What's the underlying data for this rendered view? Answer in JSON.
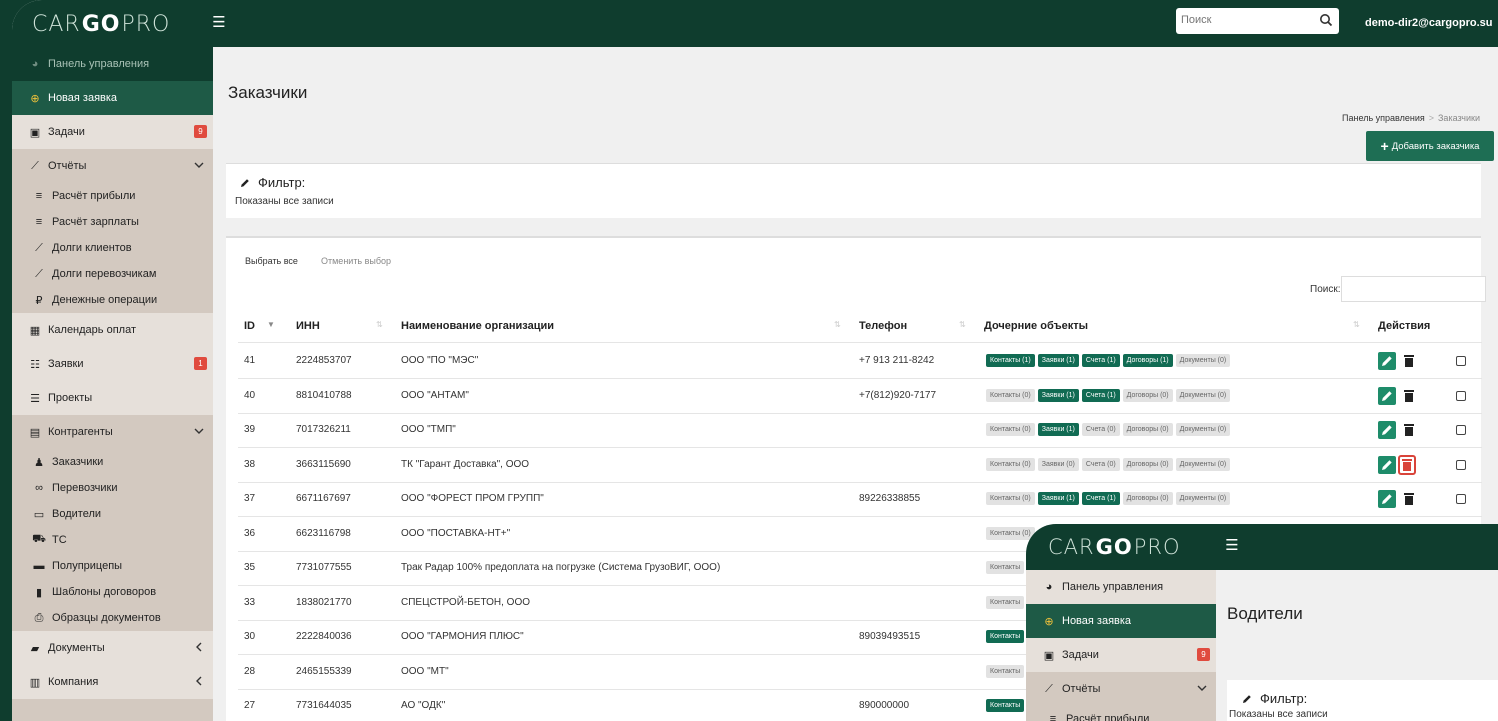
{
  "brand": {
    "logo_left": "CAR",
    "logo_go": "GO",
    "logo_right": "PRO"
  },
  "header": {
    "search_placeholder": "Поиск",
    "user": "demo-dir2@cargopro.su"
  },
  "sidebar": {
    "items": [
      {
        "label": "Панель управления",
        "icon": "palette-icon",
        "style": "dark"
      },
      {
        "label": "Новая заявка",
        "icon": "plus-circle-icon",
        "style": "green"
      },
      {
        "label": "Задачи",
        "icon": "clipboard-check-icon",
        "style": "light",
        "badge": "9"
      },
      {
        "label": "Отчёты",
        "icon": "chart-line-icon",
        "style": "plain",
        "chevron": "down"
      }
    ],
    "reports_sub": [
      {
        "label": "Расчёт прибыли",
        "icon": "bar-list-icon"
      },
      {
        "label": "Расчёт зарплаты",
        "icon": "bar-list-icon"
      },
      {
        "label": "Долги клиентов",
        "icon": "chart-line-icon"
      },
      {
        "label": "Долги перевозчикам",
        "icon": "chart-line-icon"
      },
      {
        "label": "Денежные операции",
        "icon": "ruble-icon"
      }
    ],
    "items2": [
      {
        "label": "Календарь оплат",
        "icon": "calendar-icon",
        "style": "light"
      },
      {
        "label": "Заявки",
        "icon": "table-list-icon",
        "style": "light",
        "badge": "1"
      },
      {
        "label": "Проекты",
        "icon": "list-icon",
        "style": "light"
      },
      {
        "label": "Контрагенты",
        "icon": "id-card-icon",
        "style": "plain",
        "chevron": "down"
      }
    ],
    "contractors_sub": [
      {
        "label": "Заказчики",
        "icon": "user-tie-icon"
      },
      {
        "label": "Перевозчики",
        "icon": "binoculars-icon"
      },
      {
        "label": "Водители",
        "icon": "id-badge-icon"
      },
      {
        "label": "ТС",
        "icon": "truck-icon"
      },
      {
        "label": "Полуприцепы",
        "icon": "trailer-icon"
      },
      {
        "label": "Шаблоны договоров",
        "icon": "file-icon"
      },
      {
        "label": "Образцы документов",
        "icon": "print-icon"
      }
    ],
    "items3": [
      {
        "label": "Документы",
        "icon": "folder-open-icon",
        "style": "light",
        "chevron": "left"
      },
      {
        "label": "Компания",
        "icon": "building-icon",
        "style": "light",
        "chevron": "left"
      }
    ]
  },
  "page": {
    "title": "Заказчики",
    "breadcrumb": [
      "Панель управления",
      "Заказчики"
    ],
    "add_button": "Добавить заказчика",
    "filter_title": "Фильтр:",
    "filter_sub": "Показаны все записи",
    "select_all": "Выбрать все",
    "deselect": "Отменить выбор",
    "search_label": "Поиск:",
    "columns": [
      "ID",
      "ИНН",
      "Наименование организации",
      "Телефон",
      "Дочерние объекты",
      "Действия"
    ]
  },
  "rows": [
    {
      "id": "41",
      "inn": "2224853707",
      "name": "ООО \"ПО \"МЭС\"",
      "phone": "+7 913 211-8242",
      "chips": [
        [
          "Контакты (1)",
          "g"
        ],
        [
          "Заявки (1)",
          "g"
        ],
        [
          "Счета (1)",
          "g"
        ],
        [
          "Договоры (1)",
          "g"
        ],
        [
          "Документы (0)",
          "n"
        ]
      ]
    },
    {
      "id": "40",
      "inn": "8810410788",
      "name": "ООО \"АНТАМ\"",
      "phone": "+7(812)920-7177",
      "chips": [
        [
          "Контакты (0)",
          "n"
        ],
        [
          "Заявки (1)",
          "g"
        ],
        [
          "Счета (1)",
          "g"
        ],
        [
          "Договоры (0)",
          "n"
        ],
        [
          "Документы (0)",
          "n"
        ]
      ]
    },
    {
      "id": "39",
      "inn": "7017326211",
      "name": "ООО \"ТМП\"",
      "phone": "",
      "chips": [
        [
          "Контакты (0)",
          "n"
        ],
        [
          "Заявки (1)",
          "g"
        ],
        [
          "Счета (0)",
          "n"
        ],
        [
          "Договоры (0)",
          "n"
        ],
        [
          "Документы (0)",
          "n"
        ]
      ]
    },
    {
      "id": "38",
      "inn": "3663115690",
      "name": "ТК \"Гарант Доставка\", ООО",
      "phone": "",
      "del_hl": true,
      "chips": [
        [
          "Контакты (0)",
          "n"
        ],
        [
          "Заявки (0)",
          "n"
        ],
        [
          "Счета (0)",
          "n"
        ],
        [
          "Договоры (0)",
          "n"
        ],
        [
          "Документы (0)",
          "n"
        ]
      ]
    },
    {
      "id": "37",
      "inn": "6671167697",
      "name": "ООО \"ФОРЕСТ ПРОМ ГРУПП\"",
      "phone": "89226338855",
      "chips": [
        [
          "Контакты (0)",
          "n"
        ],
        [
          "Заявки (1)",
          "g"
        ],
        [
          "Счета (1)",
          "g"
        ],
        [
          "Договоры (0)",
          "n"
        ],
        [
          "Документы (0)",
          "n"
        ]
      ]
    },
    {
      "id": "36",
      "inn": "6623116798",
      "name": "ООО \"ПОСТАВКА-НТ+\"",
      "phone": "",
      "chips": [
        [
          "Контакты (0)",
          "n"
        ]
      ]
    },
    {
      "id": "35",
      "inn": "7731077555",
      "name": "Трак Радар 100% предоплата на погрузке (Система ГрузоВИГ, ООО)",
      "phone": "",
      "chips": [
        [
          "Контакты",
          "n"
        ]
      ]
    },
    {
      "id": "33",
      "inn": "1838021770",
      "name": "СПЕЦСТРОЙ-БЕТОН, ООО",
      "phone": "",
      "chips": [
        [
          "Контакты",
          "n"
        ]
      ]
    },
    {
      "id": "30",
      "inn": "2222840036",
      "name": "ООО \"ГАРМОНИЯ ПЛЮС\"",
      "phone": "89039493515",
      "chips": [
        [
          "Контакты",
          "g"
        ]
      ]
    },
    {
      "id": "28",
      "inn": "2465155339",
      "name": "ООО \"МТ\"",
      "phone": "",
      "chips": [
        [
          "Контакты",
          "n"
        ]
      ]
    },
    {
      "id": "27",
      "inn": "7731644035",
      "name": "АО \"ОДК\"",
      "phone": "890000000",
      "chips": [
        [
          "Контакты",
          "g"
        ]
      ]
    }
  ],
  "overlay": {
    "title": "Водители",
    "filter_title": "Фильтр:",
    "filter_sub": "Показаны все записи",
    "sidebar": [
      {
        "label": "Панель управления",
        "icon": "palette-icon",
        "style": "plain2"
      },
      {
        "label": "Новая заявка",
        "icon": "plus-circle-icon",
        "style": "green"
      },
      {
        "label": "Задачи",
        "icon": "clipboard-check-icon",
        "style": "light",
        "badge": "9"
      },
      {
        "label": "Отчёты",
        "icon": "chart-line-icon",
        "style": "plain",
        "chevron": "down"
      },
      {
        "label": "Расчёт прибыли",
        "icon": "bar-list-icon",
        "style": "sub"
      }
    ]
  },
  "colors": {
    "brand_dark": "#0f3d2e",
    "accent_green": "#1e6e54",
    "badge_red": "#e04b3e"
  }
}
